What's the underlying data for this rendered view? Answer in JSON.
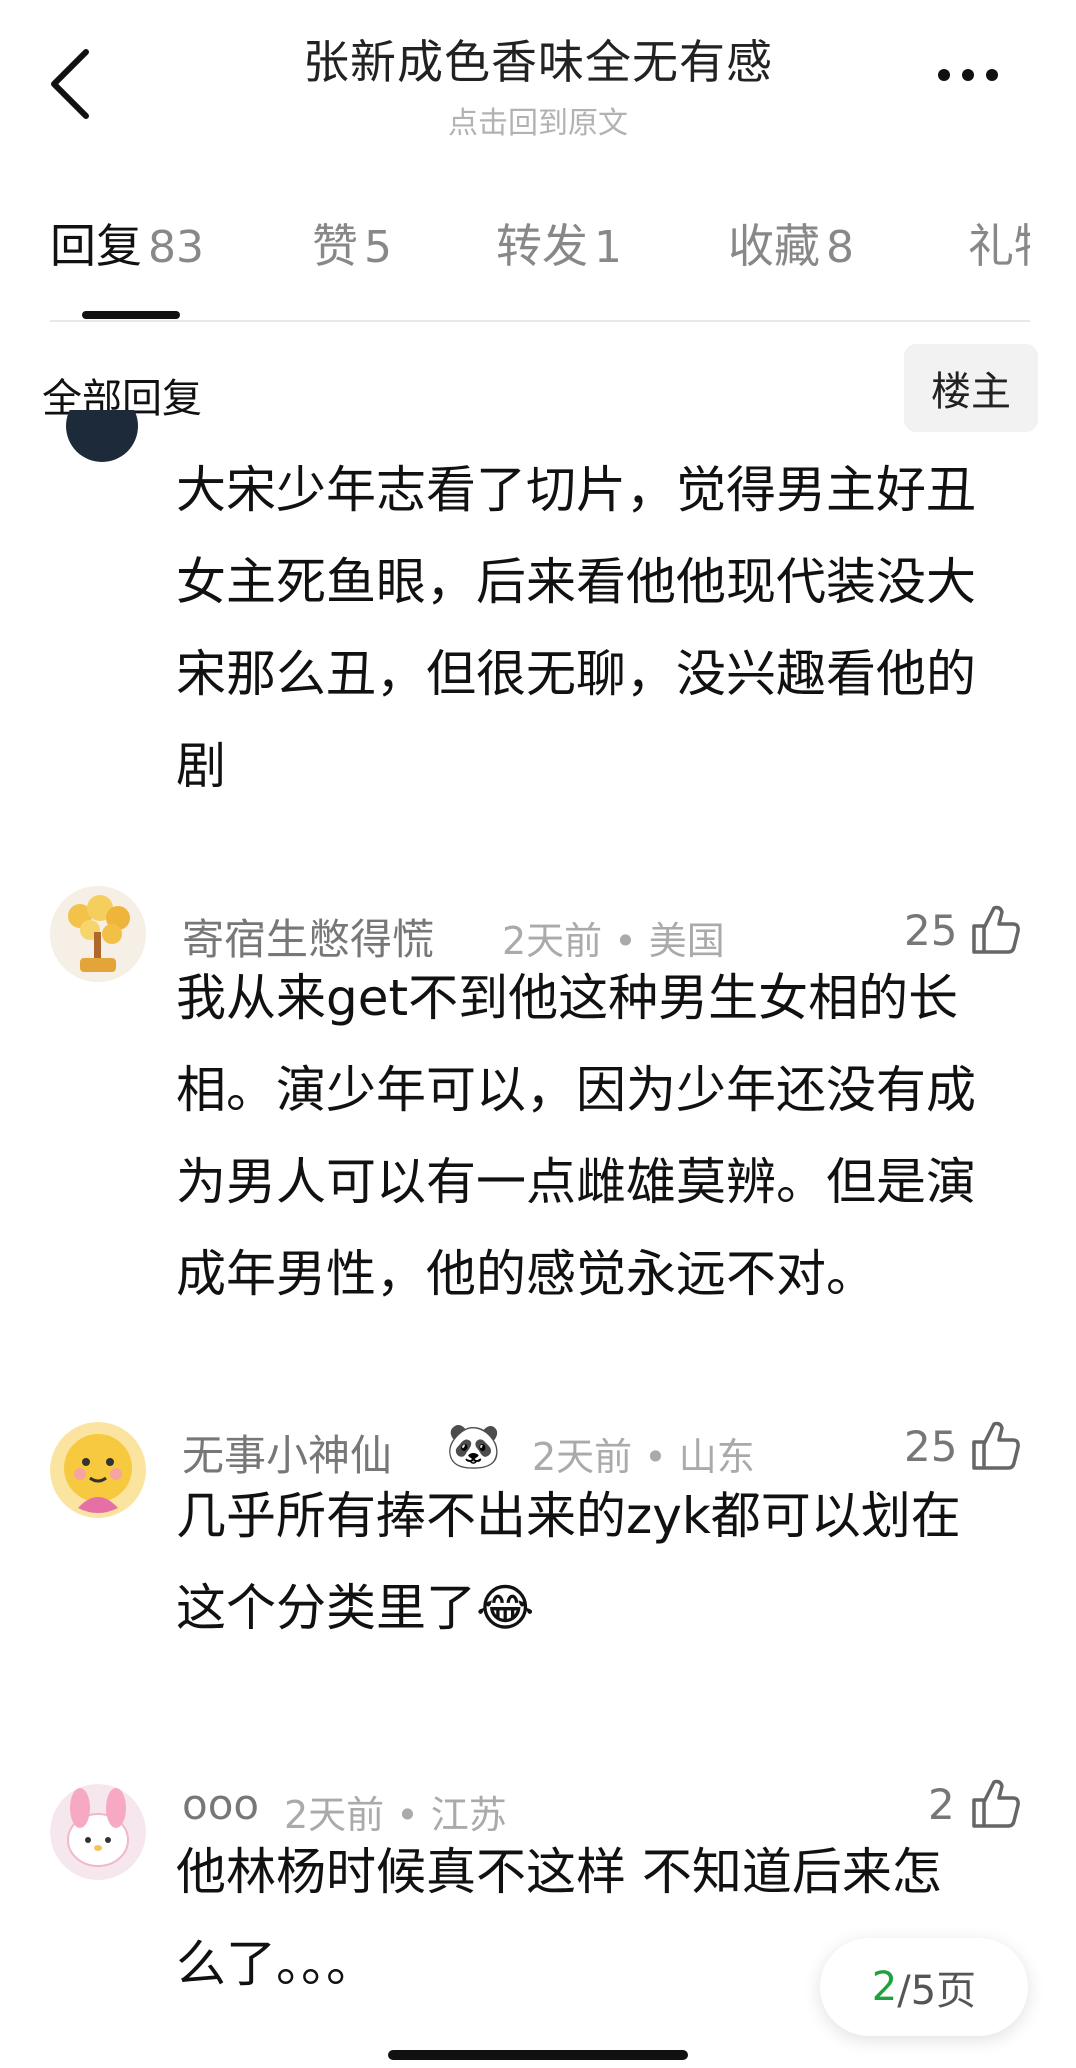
{
  "header": {
    "title": "张新成色香味全无有感",
    "subtitle": "点击回到原文"
  },
  "tabs": [
    {
      "label": "回复",
      "count": "83"
    },
    {
      "label": "赞",
      "count": "5"
    },
    {
      "label": "转发",
      "count": "1"
    },
    {
      "label": "收藏",
      "count": "8"
    },
    {
      "label": "礼物",
      "count": ""
    }
  ],
  "filter": {
    "all_label": "全部回复",
    "owner_label": "楼主"
  },
  "comments": [
    {
      "lines": [
        "大宋少年志看了切片，觉得男主好丑",
        "女主死鱼眼，后来看他他现代装没大",
        "宋那么丑，但很无聊，没兴趣看他的",
        "剧"
      ]
    },
    {
      "user": "寄宿生憋得慌",
      "meta": "2天前 • 美国",
      "likes": "25",
      "lines": [
        "我从来get不到他这种男生女相的长",
        "相。演少年可以，因为少年还没有成",
        "为男人可以有一点雌雄莫辨。但是演",
        "成年男性，他的感觉永远不对。"
      ]
    },
    {
      "user": "无事小神仙",
      "badge": "🐼",
      "meta": "2天前 • 山东",
      "likes": "25",
      "lines": [
        "几乎所有捧不出来的zyk都可以划在",
        "这个分类里了😂"
      ]
    },
    {
      "user": "ooo",
      "meta": "2天前 • 江苏",
      "likes": "2",
      "lines": [
        "他林杨时候真不这样 不知道后来怎",
        "么了。。。"
      ]
    }
  ],
  "pager": {
    "current": "2",
    "total": "/5页"
  }
}
